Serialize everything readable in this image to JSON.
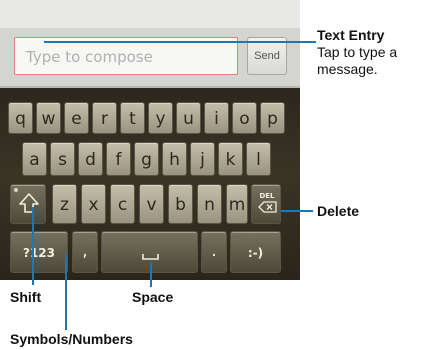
{
  "compose": {
    "placeholder": "Type to compose",
    "send_label": "Send"
  },
  "keyboard": {
    "row1": [
      "q",
      "w",
      "e",
      "r",
      "t",
      "y",
      "u",
      "i",
      "o",
      "p"
    ],
    "row2": [
      "a",
      "s",
      "d",
      "f",
      "g",
      "h",
      "j",
      "k",
      "l"
    ],
    "row3": [
      "z",
      "x",
      "c",
      "v",
      "b",
      "n",
      "m"
    ],
    "symbols_key": "?123",
    "comma_key": ",",
    "period_key": ".",
    "smiley_key": ":-)",
    "delete_key_label": "DEL"
  },
  "callouts": {
    "text_entry_title": "Text Entry",
    "text_entry_desc_line1": "Tap to type a",
    "text_entry_desc_line2": "message.",
    "delete": "Delete",
    "shift": "Shift",
    "space": "Space",
    "symbols_numbers": "Symbols/Numbers"
  },
  "colors": {
    "callout_line": "#1a78b8",
    "input_border": "#e07f80"
  }
}
